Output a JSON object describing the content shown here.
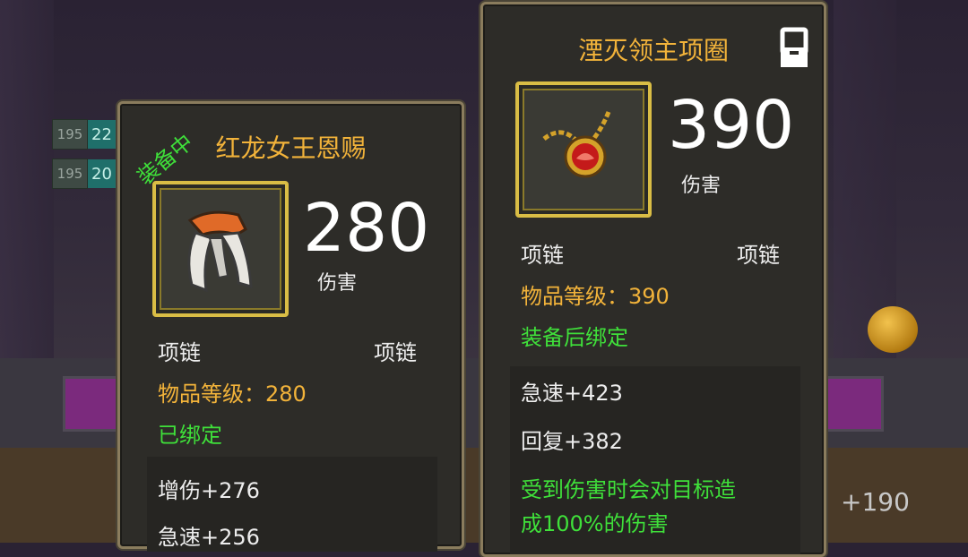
{
  "background": {
    "badges": [
      {
        "level": "195",
        "value": "22"
      },
      {
        "level": "195",
        "value": "20"
      }
    ],
    "right_number": "+190"
  },
  "left_card": {
    "equipped_tag": "装备中",
    "title": "红龙女王恩赐",
    "damage_value": "280",
    "damage_label": "伤害",
    "slot_left": "项链",
    "slot_right": "项链",
    "item_level": "物品等级：280",
    "bind_status": "已绑定",
    "stats": [
      "增伤+276",
      "急速+256"
    ]
  },
  "right_card": {
    "title": "湮灭领主项圈",
    "damage_value": "390",
    "damage_label": "伤害",
    "slot_left": "项链",
    "slot_right": "项链",
    "item_level": "物品等级：390",
    "bind_status": "装备后绑定",
    "stats": [
      "急速+423",
      "回复+382"
    ],
    "effect_line1": "受到伤害时会对目标造",
    "effect_line2": "成100%的伤害"
  },
  "colors": {
    "title_gold": "#f2b33a",
    "positive_green": "#3fe03a",
    "frame_gold": "#d9bd45"
  },
  "icons": [
    "lock-icon",
    "claw-glove-icon",
    "amulet-icon",
    "coin-icon"
  ]
}
